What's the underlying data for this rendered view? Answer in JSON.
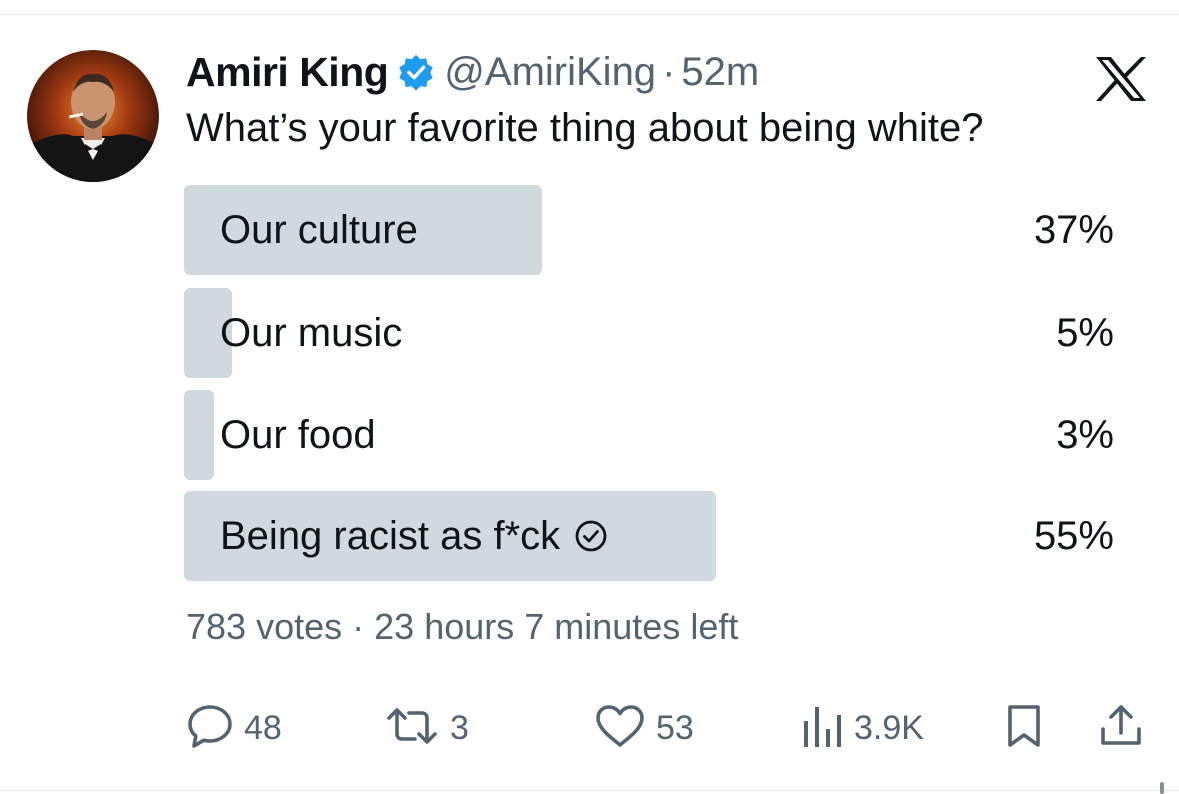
{
  "tweet": {
    "author_name": "Amiri King",
    "handle": "@AmiriKing",
    "separator": "·",
    "time": "52m",
    "text": "What’s your favorite thing about being white?"
  },
  "poll": {
    "options": [
      {
        "label": "Our culture",
        "percent_label": "37%",
        "percent": 37,
        "selected": false
      },
      {
        "label": "Our music",
        "percent_label": "5%",
        "percent": 5,
        "selected": false
      },
      {
        "label": "Our food",
        "percent_label": "3%",
        "percent": 3,
        "selected": false
      },
      {
        "label": "Being racist as f*ck",
        "percent_label": "55%",
        "percent": 55,
        "selected": true
      }
    ],
    "votes": "783 votes",
    "separator": "·",
    "time_left": "23 hours 7 minutes left"
  },
  "actions": {
    "reply_count": "48",
    "retweet_count": "3",
    "like_count": "53",
    "views_count": "3.9K"
  },
  "icons": [
    "verified-badge-icon",
    "x-logo-icon",
    "check-circle-icon",
    "reply-icon",
    "retweet-icon",
    "like-icon",
    "views-icon",
    "bookmark-icon",
    "share-icon"
  ],
  "colors": {
    "text": "#0f1419",
    "secondary": "#536471",
    "poll_fill": "#cfd9de",
    "verified": "#1d9bf0"
  }
}
